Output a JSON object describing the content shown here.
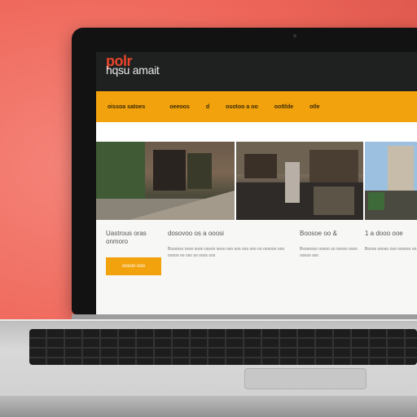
{
  "site": {
    "logo_top": "polr",
    "logo_bottom": "hqsu amait"
  },
  "nav": {
    "items": [
      {
        "label": "oissoa satoes"
      },
      {
        "label": "oeeoos"
      },
      {
        "label": "d"
      },
      {
        "label": "osotoo a oo"
      },
      {
        "label": "oottlde"
      },
      {
        "label": "otle"
      }
    ]
  },
  "photos": [
    {
      "alt": "building-photo"
    },
    {
      "alt": "street-photo"
    },
    {
      "alt": "tower-photo"
    }
  ],
  "content": {
    "col1_title": "Uastrous oras onmoro",
    "cta_label": "oosoo ooo",
    "col2_title": "dosovoo os a ooosi",
    "col2_text": "Bosooss osoo soon osson seoo oso oos oos ooo oo oosooo ooo oosoo oo oso so ooos oos",
    "col3_title": "Boosoe oo &",
    "col3_text": "Bsooosso oosoo so oooso osoo oooso oso",
    "col4_title": "1 a dooo ooe",
    "col4_text": "Booos oooso oso ooooso oo"
  }
}
